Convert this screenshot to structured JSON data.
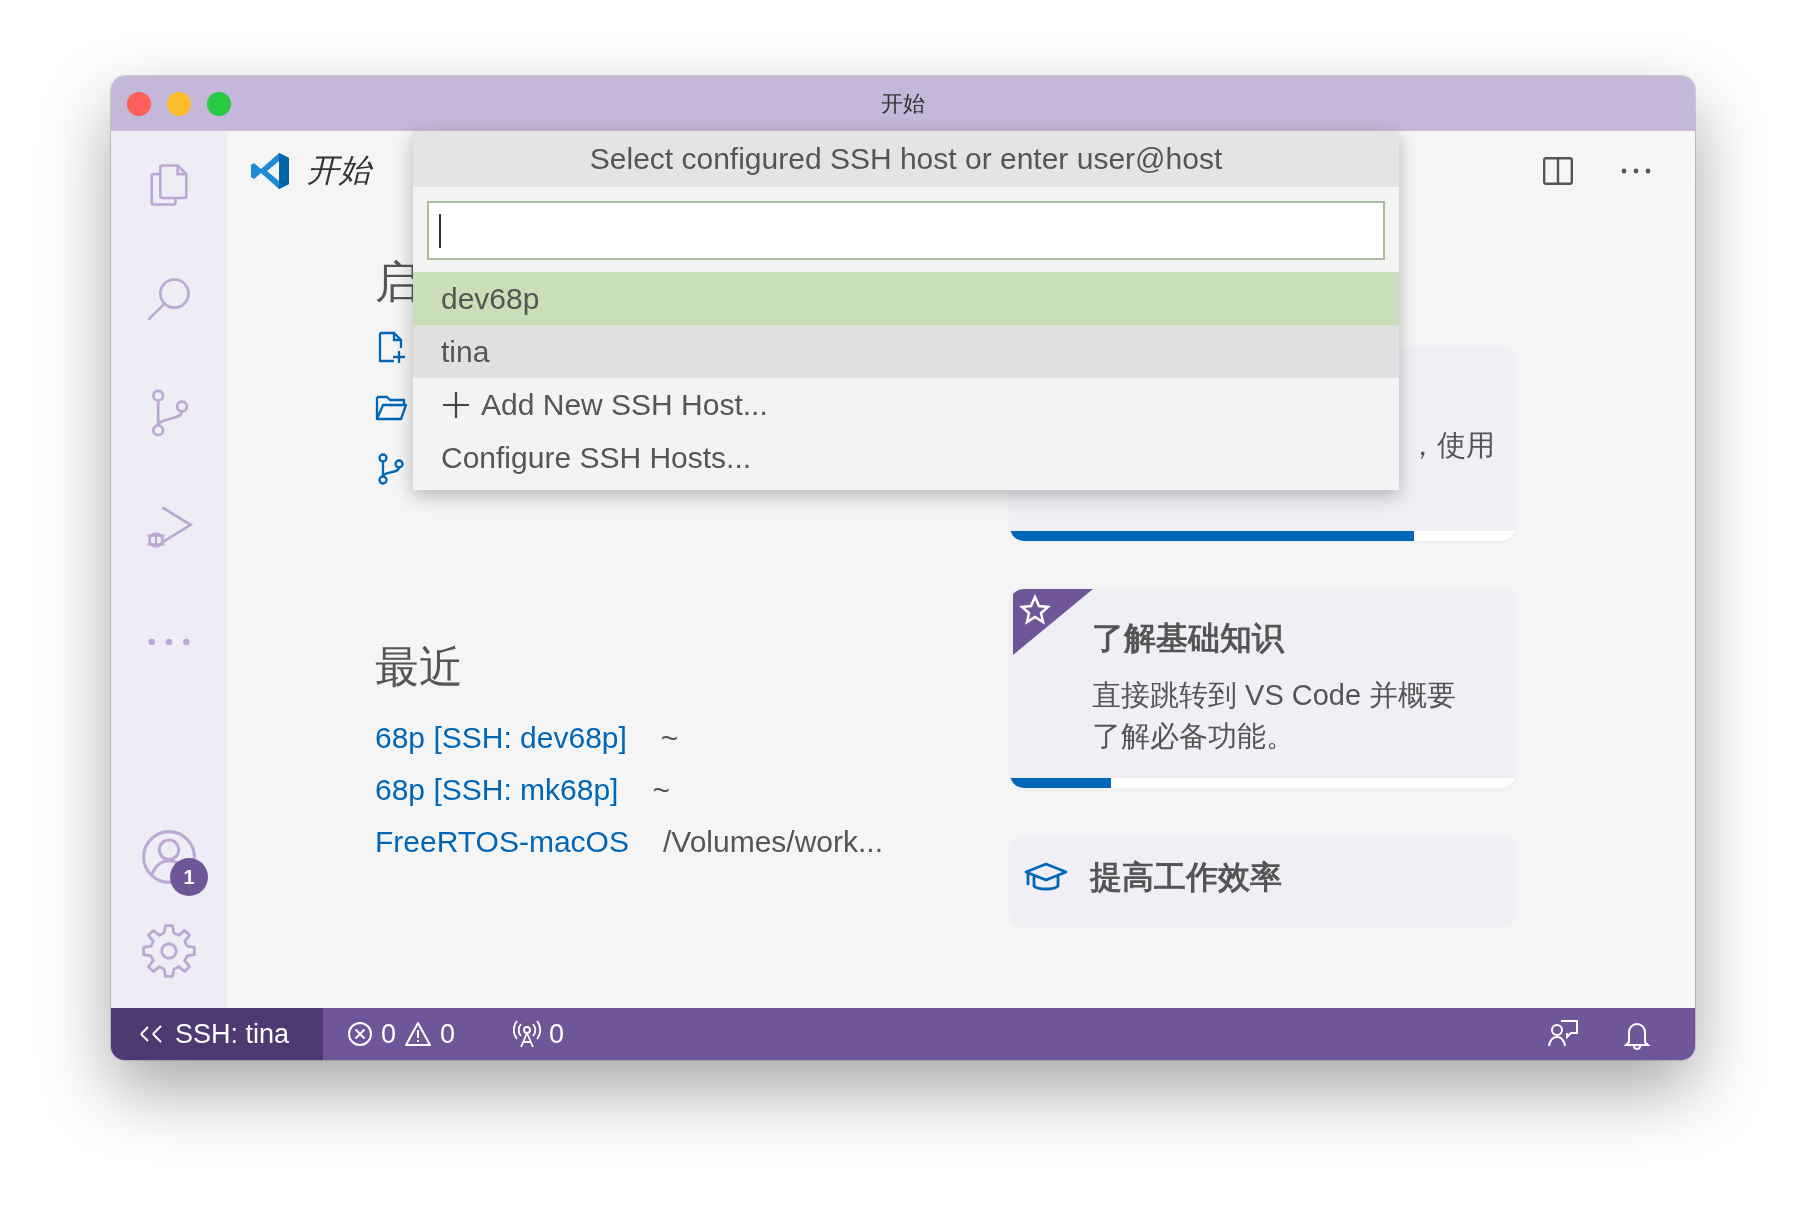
{
  "window": {
    "title": "开始"
  },
  "accounts_badge": "1",
  "editor_tab": {
    "title": "开始"
  },
  "start": {
    "heading": "启"
  },
  "recent": {
    "heading": "最近",
    "items": [
      {
        "name": "68p [SSH: dev68p]",
        "path": "~"
      },
      {
        "name": "68p [SSH: mk68p]",
        "path": "~"
      },
      {
        "name": "FreeRTOS-macOS",
        "path": "/Volumes/work..."
      }
    ]
  },
  "walkthroughs": [
    {
      "kind": "partial",
      "description": "，使用",
      "level": 0.8
    },
    {
      "kind": "featured",
      "title": "了解基础知识",
      "description": "直接跳转到 VS Code 并概要了解必备功能。",
      "level": 0.2
    },
    {
      "kind": "plain",
      "title": "提高工作效率"
    }
  ],
  "quick_pick": {
    "title": "Select configured SSH host or enter user@host",
    "items": [
      {
        "kind": "host",
        "label": "dev68p",
        "selected": true,
        "hovered": false
      },
      {
        "kind": "host",
        "label": "tina",
        "selected": false,
        "hovered": true
      },
      {
        "kind": "add",
        "label": "Add New SSH Host...",
        "selected": false,
        "hovered": false
      },
      {
        "kind": "plain",
        "label": "Configure SSH Hosts...",
        "selected": false,
        "hovered": false
      }
    ]
  },
  "status_bar": {
    "remote": "SSH: tina",
    "errors": "0",
    "warnings": "0",
    "ports": "0"
  }
}
